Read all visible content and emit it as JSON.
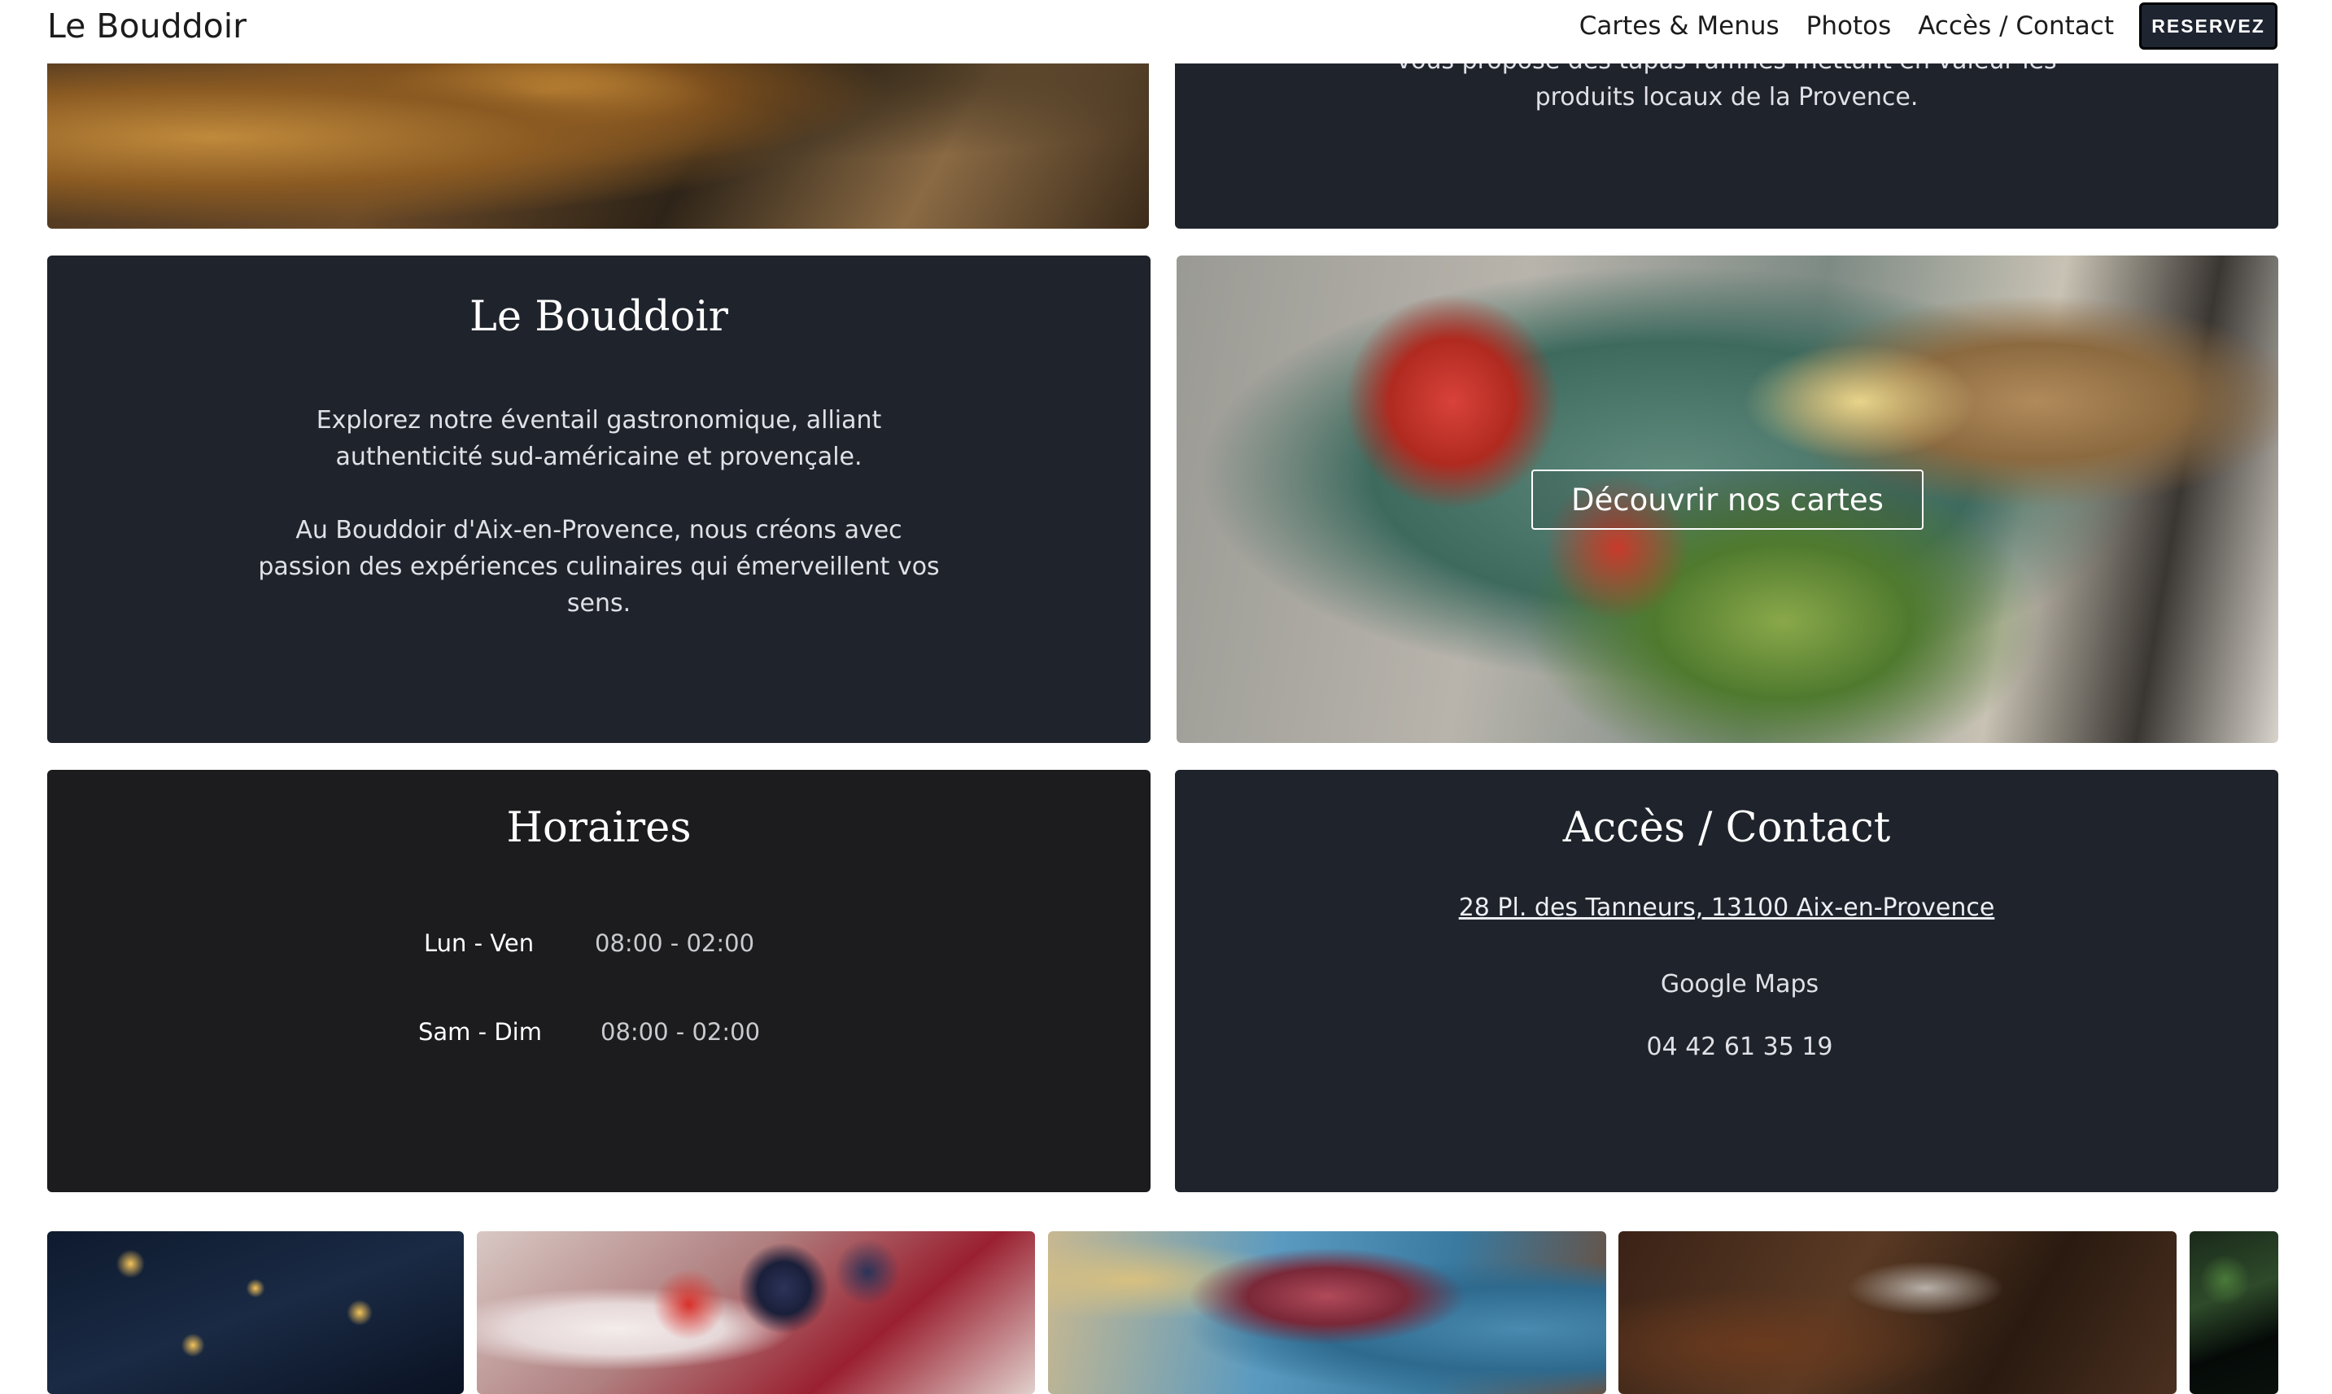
{
  "header": {
    "brand": "Le Bouddoir",
    "nav": [
      "Cartes & Menus",
      "Photos",
      "Accès / Contact"
    ],
    "reserve_label": "RESERVEZ"
  },
  "intro_card": {
    "text_line1": "vous propose des tapas raffinés mettant en valeur les",
    "text_line2": "produits locaux de la Provence."
  },
  "about_card": {
    "title": "Le Bouddoir",
    "para1_line1": "Explorez notre éventail gastronomique, alliant",
    "para1_line2": "authenticité sud-américaine et provençale.",
    "para2_line1": "Au Bouddoir d'Aix-en-Provence, nous créons avec",
    "para2_line2": "passion des expériences culinaires qui émerveillent vos",
    "para2_line3": "sens."
  },
  "menu_card": {
    "button_label": "Découvrir nos cartes"
  },
  "hours_card": {
    "title": "Horaires",
    "rows": [
      {
        "days": "Lun - Ven",
        "time": "08:00 - 02:00"
      },
      {
        "days": "Sam - Dim",
        "time": "08:00 - 02:00"
      }
    ]
  },
  "contact_card": {
    "title": "Accès / Contact",
    "address": "28 Pl. des Tanneurs, 13100 Aix-en-Provence",
    "maps_label": "Google Maps",
    "phone": "04 42 61 35 19"
  },
  "colors": {
    "card_dark": "#1f232c",
    "card_darker": "#1c1c1e",
    "button_dark": "#1e2430"
  }
}
